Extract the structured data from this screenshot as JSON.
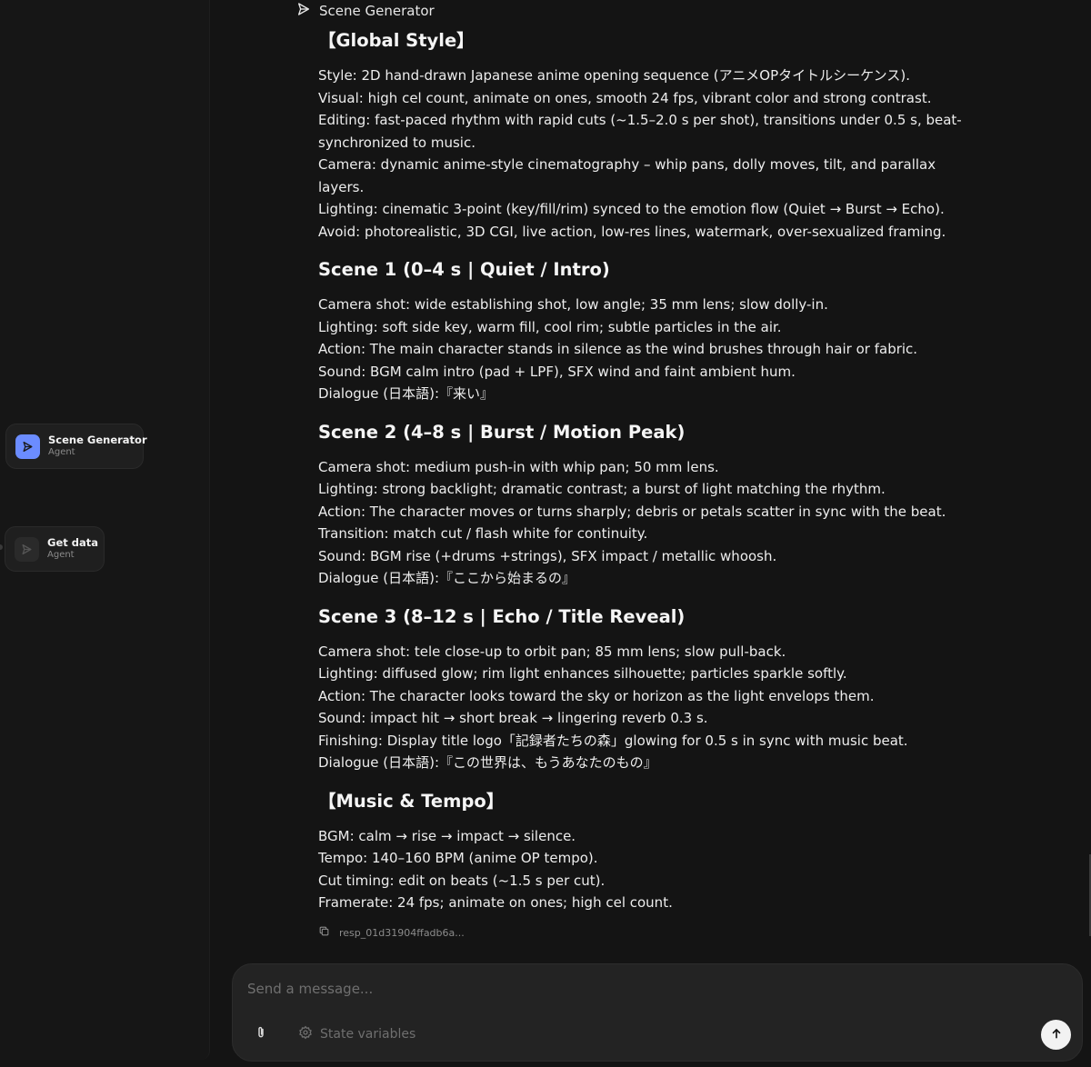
{
  "canvas": {
    "nodes": [
      {
        "title": "Scene Generator",
        "subtitle": "Agent"
      },
      {
        "title": "Get data",
        "subtitle": "Agent"
      }
    ]
  },
  "chat": {
    "agent_name": "Scene Generator",
    "sections": [
      {
        "heading": "【Global Style】",
        "lines": [
          "Style: 2D hand-drawn Japanese anime opening sequence (アニメOPタイトルシーケンス).",
          "Visual: high cel count, animate on ones, smooth 24 fps, vibrant color and strong contrast.",
          "Editing: fast-paced rhythm with rapid cuts (~1.5–2.0 s per shot), transitions under 0.5 s, beat-synchronized to music.",
          "Camera: dynamic anime-style cinematography – whip pans, dolly moves, tilt, and parallax layers.",
          "Lighting: cinematic 3-point (key/fill/rim) synced to the emotion flow (Quiet → Burst → Echo).",
          "Avoid: photorealistic, 3D CGI, live action, low-res lines, watermark, over-sexualized framing."
        ]
      },
      {
        "heading": "Scene 1 (0–4 s | Quiet / Intro)",
        "lines": [
          "Camera shot: wide establishing shot, low angle; 35 mm lens; slow dolly-in.",
          "Lighting: soft side key, warm fill, cool rim; subtle particles in the air.",
          "Action: The main character stands in silence as the wind brushes through hair or fabric.",
          "Sound: BGM calm intro (pad + LPF), SFX wind and faint ambient hum.",
          "Dialogue (日本語):『来い』"
        ]
      },
      {
        "heading": "Scene 2 (4–8 s | Burst / Motion Peak)",
        "lines": [
          "Camera shot: medium push-in with whip pan; 50 mm lens.",
          "Lighting: strong backlight; dramatic contrast; a burst of light matching the rhythm.",
          "Action: The character moves or turns sharply; debris or petals scatter in sync with the beat.",
          "Transition: match cut / flash white for continuity.",
          "Sound: BGM rise (+drums +strings), SFX impact / metallic whoosh.",
          "Dialogue (日本語):『ここから始まるの』"
        ]
      },
      {
        "heading": "Scene 3 (8–12 s | Echo / Title Reveal)",
        "lines": [
          "Camera shot: tele close-up to orbit pan; 85 mm lens; slow pull-back.",
          "Lighting: diffused glow; rim light enhances silhouette; particles sparkle softly.",
          "Action: The character looks toward the sky or horizon as the light envelops them.",
          "Sound: impact hit → short break → lingering reverb 0.3 s.",
          "Finishing: Display title logo「記録者たちの森」glowing for 0.5 s in sync with music beat.",
          "Dialogue (日本語):『この世界は、もうあなたのもの』"
        ]
      },
      {
        "heading": "【Music & Tempo】",
        "lines": [
          "BGM: calm → rise → impact → silence.",
          "Tempo: 140–160 BPM (anime OP tempo).",
          "Cut timing: edit on beats (~1.5 s per cut).",
          "Framerate: 24 fps; animate on ones; high cel count."
        ]
      }
    ],
    "response_id": "resp_01d31904ffadb6a..."
  },
  "composer": {
    "placeholder": "Send a message...",
    "state_variables_label": "State variables"
  },
  "colors": {
    "accent": "#6b8cff",
    "background": "#141414",
    "panel": "#232323"
  },
  "icons": {
    "agent": "paper-plane-icon",
    "attach": "paperclip-icon",
    "state": "gear-icon",
    "send": "arrow-up-icon",
    "copy": "copy-icon"
  }
}
